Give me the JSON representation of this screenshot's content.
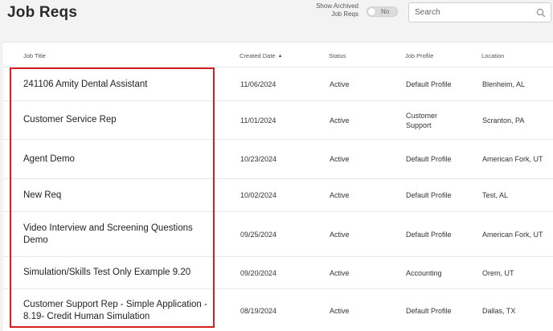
{
  "header": {
    "title": "Job Reqs",
    "archived_label": "Show Archived Job Reqs",
    "archived_toggle": "No",
    "search_placeholder": "Search"
  },
  "table": {
    "columns": [
      "Job Title",
      "Created Date",
      "Status",
      "Job Profile",
      "Location"
    ],
    "sorted_column": "Created Date",
    "sort_direction": "ascending",
    "rows": [
      {
        "title": "241106 Amity Dental Assistant",
        "date": "11/06/2024",
        "status": "Active",
        "profile": "Default Profile",
        "location": "Blenheim, AL"
      },
      {
        "title": "Customer Service Rep",
        "date": "11/01/2024",
        "status": "Active",
        "profile": "Customer Support",
        "location": "Scranton, PA"
      },
      {
        "title": "Agent Demo",
        "date": "10/23/2024",
        "status": "Active",
        "profile": "Default Profile",
        "location": "American Fork, UT"
      },
      {
        "title": "New Req",
        "date": "10/02/2024",
        "status": "Active",
        "profile": "Default Profile",
        "location": "Test, AL"
      },
      {
        "title": "Video Interview and Screening Questions Demo",
        "date": "09/25/2024",
        "status": "Active",
        "profile": "Default Profile",
        "location": "American Fork, UT"
      },
      {
        "title": "Simulation/Skills Test Only Example 9.20",
        "date": "09/20/2024",
        "status": "Active",
        "profile": "Accounting",
        "location": "Orem, UT"
      },
      {
        "title": "Customer Support Rep - Simple Application - 8.19- Credit Human Simulation",
        "date": "08/19/2024",
        "status": "Active",
        "profile": "Default Profile",
        "location": "Dallas, TX"
      }
    ]
  },
  "colors": {
    "highlight": "#d42020",
    "background": "#f3f3f3"
  }
}
